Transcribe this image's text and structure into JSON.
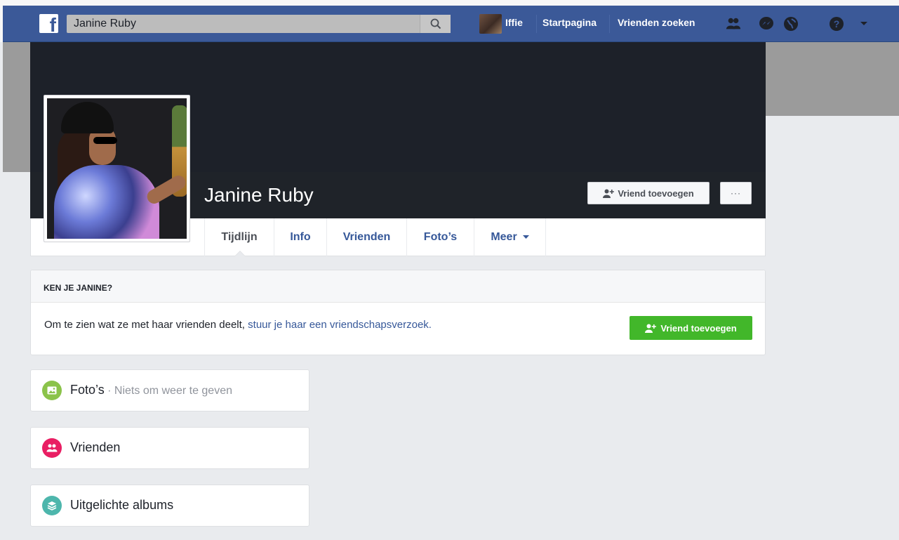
{
  "colors": {
    "brand": "#3b5998",
    "link": "#365899",
    "green": "#42b72a",
    "photos_icon": "#8bc34a",
    "friends_icon": "#e91e63",
    "albums_icon": "#4db6ac"
  },
  "topnav": {
    "search_value": "Janine Ruby",
    "user_name": "Iffie",
    "home_label": "Startpagina",
    "find_friends_label": "Vrienden zoeken"
  },
  "profile": {
    "name": "Janine Ruby",
    "add_friend_label": "Vriend toevoegen",
    "more_label": "···"
  },
  "tabs": [
    {
      "label": "Tijdlijn"
    },
    {
      "label": "Info"
    },
    {
      "label": "Vrienden"
    },
    {
      "label": "Foto’s"
    },
    {
      "label": "Meer"
    }
  ],
  "know_card": {
    "heading": "KEN JE JANINE?",
    "text": "Om te zien wat ze met haar vrienden deelt,",
    "link_text": "stuur je haar een vriendschapsverzoek.",
    "button_label": "Vriend toevoegen"
  },
  "side_cards": {
    "photos": {
      "title": "Foto’s",
      "subtitle": " · Niets om weer te geven"
    },
    "friends": {
      "title": "Vrienden"
    },
    "albums": {
      "title": "Uitgelichte albums"
    }
  }
}
